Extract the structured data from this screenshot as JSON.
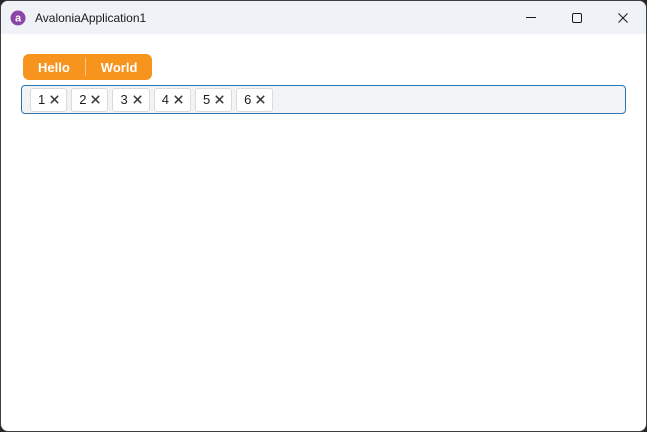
{
  "window": {
    "title": "AvaloniaApplication1",
    "app_icon": "avalonia-logo-icon",
    "controls": [
      {
        "name": "minimize",
        "icon": "minimize-icon"
      },
      {
        "name": "maximize",
        "icon": "maximize-icon"
      },
      {
        "name": "close",
        "icon": "close-icon"
      }
    ]
  },
  "colors": {
    "titlebar_bg": "#EFF2F7",
    "accent_orange": "#F7941E",
    "tagbox_border": "#2E74B0",
    "tagbox_bg": "#F2F3F5",
    "logo_purple": "#8B44A8"
  },
  "split_button": {
    "labels": [
      "Hello",
      "World"
    ]
  },
  "tagbox": {
    "tags": [
      "1",
      "2",
      "3",
      "4",
      "5",
      "6"
    ],
    "remove_icon": "close-x-icon"
  }
}
